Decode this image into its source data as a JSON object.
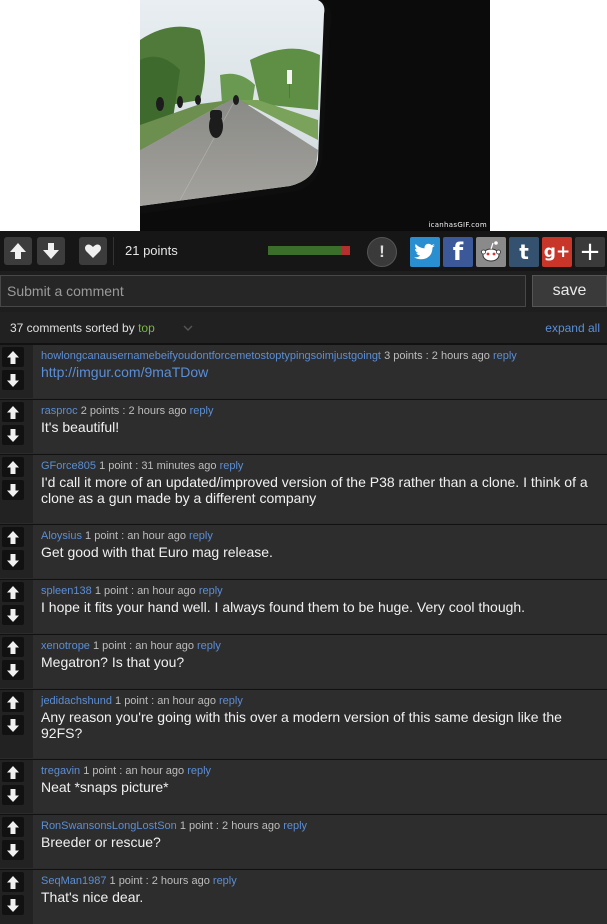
{
  "gif": {
    "watermark": "icanhasGIF.com"
  },
  "action_bar": {
    "points": "21 points",
    "score_fraction": 0.9,
    "report_label": "!",
    "share": [
      {
        "name": "twitter",
        "glyph": "",
        "color": "#2a8fd0"
      },
      {
        "name": "facebook",
        "glyph": "f",
        "color": "#3b5998"
      },
      {
        "name": "reddit",
        "glyph": "",
        "color": "#8a8a8a"
      },
      {
        "name": "tumblr",
        "glyph": "t",
        "color": "#34526f"
      },
      {
        "name": "googleplus",
        "glyph": "g+",
        "color": "#c8362a"
      },
      {
        "name": "more",
        "glyph": "+",
        "color": "#3a3a3a"
      }
    ]
  },
  "submit": {
    "placeholder": "Submit a comment",
    "save_label": "save"
  },
  "sort": {
    "prefix": "37 comments sorted by ",
    "selected": "top",
    "expand_label": "expand all"
  },
  "comments": [
    {
      "user": "howlongcanausernamebeifyoudontforcemetostoptypingsoimjustgoingt",
      "points": "3 points",
      "time": "2 hours ago",
      "reply": "reply",
      "text": "http://imgur.com/9maTDow",
      "is_link": true
    },
    {
      "user": "rasproc",
      "points": "2 points",
      "time": "2 hours ago",
      "reply": "reply",
      "text": "It's beautiful!"
    },
    {
      "user": "GForce805",
      "points": "1 point",
      "time": "31 minutes ago",
      "reply": "reply",
      "text": "I'd call it more of an updated/improved version of the P38 rather than a clone. I think of a clone as a gun made by a different company"
    },
    {
      "user": "Aloysius",
      "points": "1 point",
      "time": "an hour ago",
      "reply": "reply",
      "text": "Get good with that Euro mag release."
    },
    {
      "user": "spleen138",
      "points": "1 point",
      "time": "an hour ago",
      "reply": "reply",
      "text": "I hope it fits your hand well. I always found them to be huge. Very cool though."
    },
    {
      "user": "xenotrope",
      "points": "1 point",
      "time": "an hour ago",
      "reply": "reply",
      "text": "Megatron? Is that you?"
    },
    {
      "user": "jedidachshund",
      "points": "1 point",
      "time": "an hour ago",
      "reply": "reply",
      "text": "Any reason you're going with this over a modern version of this same design like the 92FS?"
    },
    {
      "user": "tregavin",
      "points": "1 point",
      "time": "an hour ago",
      "reply": "reply",
      "text": "Neat *snaps picture*"
    },
    {
      "user": "RonSwansonsLongLostSon",
      "points": "1 point",
      "time": "2 hours ago",
      "reply": "reply",
      "text": "Breeder or rescue?"
    },
    {
      "user": "SeqMan1987",
      "points": "1 point",
      "time": "2 hours ago",
      "reply": "reply",
      "text": "That's nice dear."
    }
  ]
}
